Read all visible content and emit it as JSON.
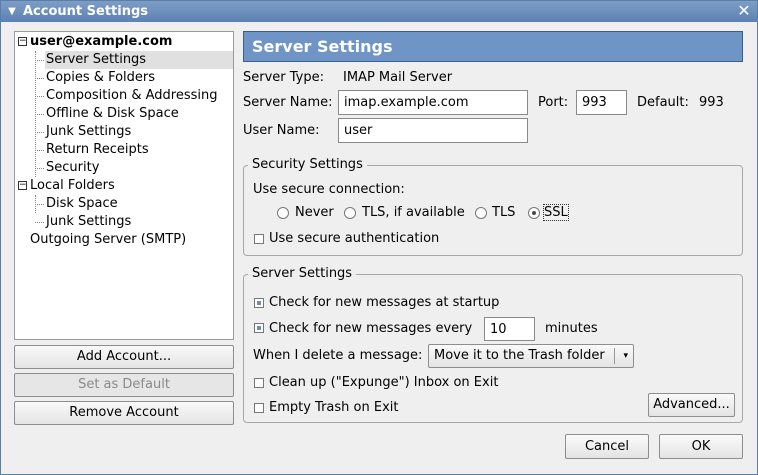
{
  "window": {
    "title": "Account Settings"
  },
  "tree": {
    "account": "user@example.com",
    "account_items": [
      "Server Settings",
      "Copies & Folders",
      "Composition & Addressing",
      "Offline & Disk Space",
      "Junk Settings",
      "Return Receipts",
      "Security"
    ],
    "local": "Local Folders",
    "local_items": [
      "Disk Space",
      "Junk Settings"
    ],
    "outgoing": "Outgoing Server (SMTP)"
  },
  "left_buttons": {
    "add": "Add Account...",
    "default": "Set as Default",
    "remove": "Remove Account"
  },
  "panel": {
    "title": "Server Settings",
    "server_type_label": "Server Type:",
    "server_type_value": "IMAP Mail Server",
    "server_name_label": "Server Name:",
    "server_name_value": "imap.example.com",
    "port_label": "Port:",
    "port_value": "993",
    "default_label": "Default:",
    "default_value": "993",
    "user_name_label": "User Name:",
    "user_name_value": "user"
  },
  "security": {
    "title": "Security Settings",
    "secure_conn_label": "Use secure connection:",
    "options": [
      "Never",
      "TLS, if available",
      "TLS",
      "SSL"
    ],
    "selected": "SSL",
    "secure_auth": "Use secure authentication"
  },
  "server_settings": {
    "title": "Server Settings",
    "check_startup": "Check for new messages at startup",
    "check_every": "Check for new messages every",
    "minutes_value": "10",
    "minutes_label": "minutes",
    "delete_label": "When I delete a message:",
    "delete_option": "Move it to the Trash folder",
    "cleanup": "Clean up (\"Expunge\") Inbox on Exit",
    "empty_trash": "Empty Trash on Exit",
    "advanced": "Advanced..."
  },
  "footer": {
    "cancel": "Cancel",
    "ok": "OK"
  }
}
